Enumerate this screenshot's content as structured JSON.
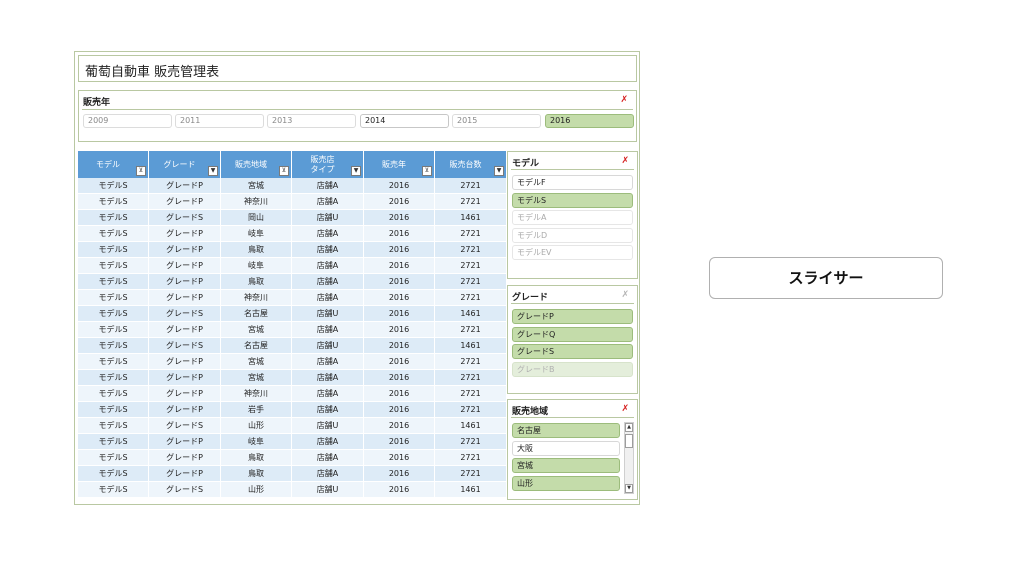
{
  "title": "葡萄自動車 販売管理表",
  "year_slicer": {
    "header": "販売年",
    "clear": "✗",
    "items": [
      {
        "label": "2009",
        "state": "empty"
      },
      {
        "label": "2011",
        "state": "empty"
      },
      {
        "label": "2013",
        "state": "empty"
      },
      {
        "label": "2014",
        "state": "avail"
      },
      {
        "label": "2015",
        "state": "empty"
      },
      {
        "label": "2016",
        "state": "sel"
      }
    ]
  },
  "table": {
    "headers": [
      {
        "label": "モデル",
        "btn": "filter"
      },
      {
        "label": "グレード",
        "btn": "dropdown"
      },
      {
        "label": "販売地域",
        "btn": "filter"
      },
      {
        "label": "販売店\nタイプ",
        "btn": "dropdown"
      },
      {
        "label": "販売年",
        "btn": "filter"
      },
      {
        "label": "販売台数",
        "btn": "dropdown"
      }
    ],
    "rows": [
      [
        "モデルS",
        "グレードP",
        "宮城",
        "店舗A",
        "2016",
        "2721"
      ],
      [
        "モデルS",
        "グレードP",
        "神奈川",
        "店舗A",
        "2016",
        "2721"
      ],
      [
        "モデルS",
        "グレードS",
        "岡山",
        "店舗U",
        "2016",
        "1461"
      ],
      [
        "モデルS",
        "グレードP",
        "岐阜",
        "店舗A",
        "2016",
        "2721"
      ],
      [
        "モデルS",
        "グレードP",
        "鳥取",
        "店舗A",
        "2016",
        "2721"
      ],
      [
        "モデルS",
        "グレードP",
        "岐阜",
        "店舗A",
        "2016",
        "2721"
      ],
      [
        "モデルS",
        "グレードP",
        "鳥取",
        "店舗A",
        "2016",
        "2721"
      ],
      [
        "モデルS",
        "グレードP",
        "神奈川",
        "店舗A",
        "2016",
        "2721"
      ],
      [
        "モデルS",
        "グレードS",
        "名古屋",
        "店舗U",
        "2016",
        "1461"
      ],
      [
        "モデルS",
        "グレードP",
        "宮城",
        "店舗A",
        "2016",
        "2721"
      ],
      [
        "モデルS",
        "グレードS",
        "名古屋",
        "店舗U",
        "2016",
        "1461"
      ],
      [
        "モデルS",
        "グレードP",
        "宮城",
        "店舗A",
        "2016",
        "2721"
      ],
      [
        "モデルS",
        "グレードP",
        "宮城",
        "店舗A",
        "2016",
        "2721"
      ],
      [
        "モデルS",
        "グレードP",
        "神奈川",
        "店舗A",
        "2016",
        "2721"
      ],
      [
        "モデルS",
        "グレードP",
        "岩手",
        "店舗A",
        "2016",
        "2721"
      ],
      [
        "モデルS",
        "グレードS",
        "山形",
        "店舗U",
        "2016",
        "1461"
      ],
      [
        "モデルS",
        "グレードP",
        "岐阜",
        "店舗A",
        "2016",
        "2721"
      ],
      [
        "モデルS",
        "グレードP",
        "鳥取",
        "店舗A",
        "2016",
        "2721"
      ],
      [
        "モデルS",
        "グレードP",
        "鳥取",
        "店舗A",
        "2016",
        "2721"
      ],
      [
        "モデルS",
        "グレードS",
        "山形",
        "店舗U",
        "2016",
        "1461"
      ]
    ]
  },
  "model_slicer": {
    "header": "モデル",
    "clear": "✗",
    "items": [
      {
        "label": "モデルF",
        "state": "avail"
      },
      {
        "label": "モデルS",
        "state": "sel"
      },
      {
        "label": "モデルA",
        "state": "dim"
      },
      {
        "label": "モデルD",
        "state": "dim"
      },
      {
        "label": "モデルEV",
        "state": "dim"
      }
    ]
  },
  "grade_slicer": {
    "header": "グレード",
    "clear": "✗",
    "items": [
      {
        "label": "グレードP",
        "state": "sel"
      },
      {
        "label": "グレードQ",
        "state": "sel"
      },
      {
        "label": "グレードS",
        "state": "sel"
      },
      {
        "label": "グレードB",
        "state": "dimsel"
      }
    ]
  },
  "region_slicer": {
    "header": "販売地域",
    "clear": "✗",
    "items": [
      {
        "label": "名古屋",
        "state": "sel"
      },
      {
        "label": "大阪",
        "state": "avail"
      },
      {
        "label": "宮城",
        "state": "sel"
      },
      {
        "label": "山形",
        "state": "sel"
      }
    ]
  },
  "callout": "スライサー"
}
